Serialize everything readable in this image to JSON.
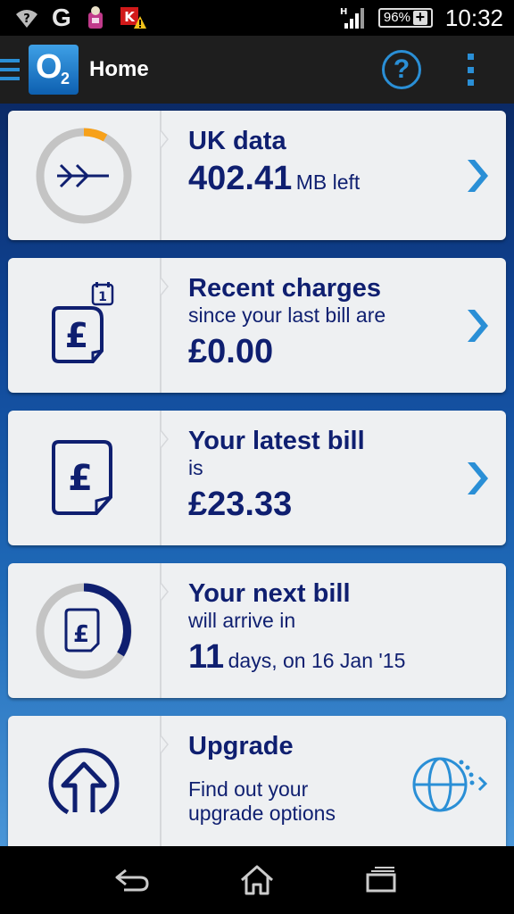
{
  "status_bar": {
    "left_icons": [
      "wifi-question-icon",
      "google-icon",
      "notification-app-icon",
      "warning-app-icon"
    ],
    "signal_label": "H",
    "battery": "96%",
    "time": "10:32"
  },
  "action_bar": {
    "brand": {
      "letter": "O",
      "subscript": "2"
    },
    "title": "Home",
    "help_label": "?"
  },
  "cards": {
    "data": {
      "title": "UK data",
      "amount": "402.41",
      "unit": "MB left"
    },
    "recent": {
      "title": "Recent charges",
      "subtitle": "since your last bill are",
      "amount": "£0.00",
      "calendar_num": "1"
    },
    "latest": {
      "title": "Your latest bill",
      "subtitle": "is",
      "amount": "£23.33"
    },
    "next": {
      "title": "Your next bill",
      "subtitle": "will arrive in",
      "days": "11",
      "date_text": "days, on 16 Jan '15"
    },
    "upgrade": {
      "title": "Upgrade",
      "line1": "Find out your",
      "line2": "upgrade options"
    }
  },
  "pound_symbol": "£",
  "colors": {
    "accent": "#2a8fd6",
    "navy": "#0f1f70",
    "data_ring_usage": "#f7a11a",
    "card_bg": "#eef0f2"
  }
}
